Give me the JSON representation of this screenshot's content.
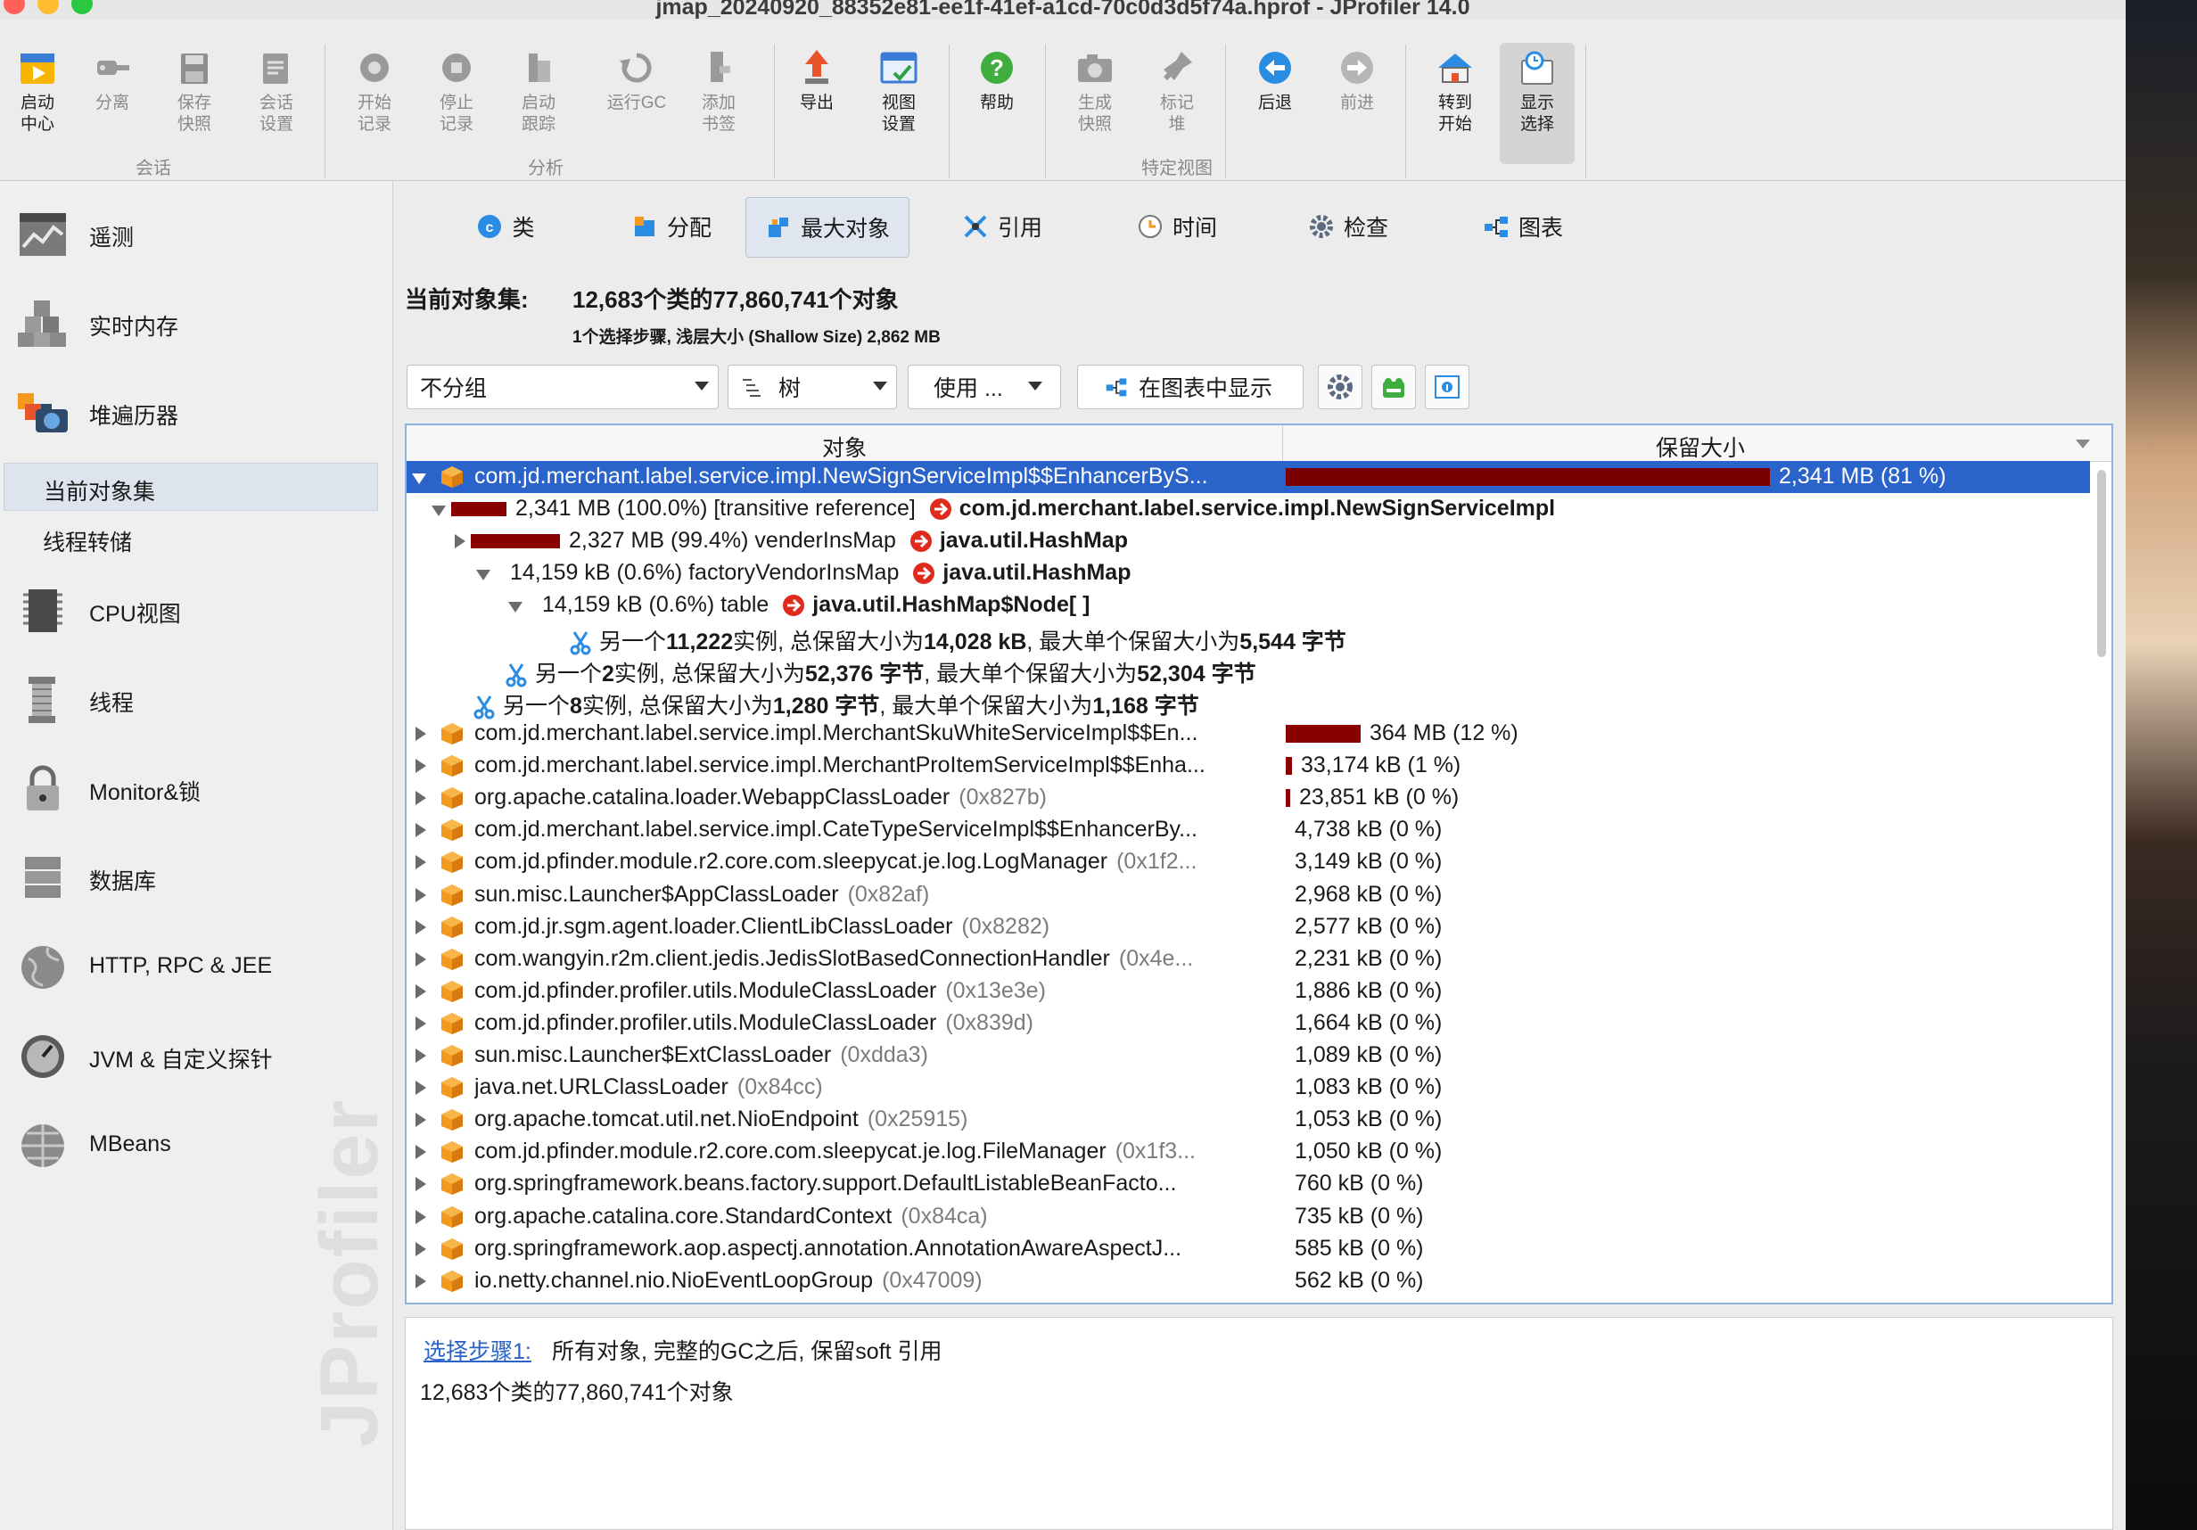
{
  "window": {
    "title": "jmap_20240920_88352e81-ee1f-41ef-a1cd-70c0d3d5f74a.hprof - JProfiler 14.0",
    "watermark": "JProfiler"
  },
  "toolbar": {
    "buttons": [
      {
        "label": "启动\n中心",
        "icon": "launcher-icon"
      },
      {
        "label": "分离",
        "icon": "detach-icon"
      },
      {
        "label": "保存\n快照",
        "icon": "save-icon"
      },
      {
        "label": "会话\n设置",
        "icon": "session-settings-icon"
      },
      {
        "label": "开始\n记录",
        "icon": "start-recording-icon"
      },
      {
        "label": "停止\n记录",
        "icon": "stop-recording-icon"
      },
      {
        "label": "启动\n跟踪",
        "icon": "start-tracking-icon"
      },
      {
        "label": "运行GC",
        "icon": "run-gc-icon"
      },
      {
        "label": "添加\n书签",
        "icon": "bookmark-icon"
      },
      {
        "label": "导出",
        "icon": "export-icon"
      },
      {
        "label": "视图\n设置",
        "icon": "view-settings-icon"
      },
      {
        "label": "帮助",
        "icon": "help-icon"
      },
      {
        "label": "生成\n快照",
        "icon": "snapshot-icon"
      },
      {
        "label": "标记\n堆",
        "icon": "mark-heap-icon"
      },
      {
        "label": "后退",
        "icon": "back-icon"
      },
      {
        "label": "前进",
        "icon": "forward-icon"
      },
      {
        "label": "转到\n开始",
        "icon": "home-icon"
      },
      {
        "label": "显示\n选择",
        "icon": "show-selection-icon"
      }
    ],
    "groups": {
      "session": "会话",
      "profiling": "分析",
      "view": "特定视图"
    }
  },
  "sidebar": {
    "items": [
      {
        "label": "遥测"
      },
      {
        "label": "实时内存"
      },
      {
        "label": "堆遍历器"
      },
      {
        "label": "CPU视图"
      },
      {
        "label": "线程"
      },
      {
        "label": "Monitor&锁"
      },
      {
        "label": "数据库"
      },
      {
        "label": "HTTP, RPC & JEE"
      },
      {
        "label": "JVM & 自定义探针"
      },
      {
        "label": "MBeans"
      }
    ],
    "sub_items": [
      {
        "label": "当前对象集"
      },
      {
        "label": "线程转储"
      }
    ]
  },
  "tabs": [
    {
      "label": "类"
    },
    {
      "label": "分配"
    },
    {
      "label": "最大对象"
    },
    {
      "label": "引用"
    },
    {
      "label": "时间"
    },
    {
      "label": "检查"
    },
    {
      "label": "图表"
    }
  ],
  "object_set": {
    "label": "当前对象集:",
    "value": "12,683个类的77,860,741个对象",
    "sub": "1个选择步骤, 浅层大小 (Shallow Size) 2,862 MB"
  },
  "controls": {
    "grouping": "不分组",
    "view_mode": "树",
    "use": "使用 ...",
    "show_in_graph": "在图表中显示"
  },
  "table": {
    "col_object": "对象",
    "col_retained": "保留大小",
    "rows": [
      {
        "name": "com.jd.merchant.label.service.impl.NewSignServiceImpl$$EnhancerByS...",
        "id": "",
        "retained": "2,341 MB (81 %)",
        "pct": 0.81
      },
      {
        "name": "com.jd.merchant.label.service.impl.MerchantSkuWhiteServiceImpl$$En...",
        "id": "",
        "retained": "364 MB (12 %)",
        "pct": 0.126
      },
      {
        "name": "com.jd.merchant.label.service.impl.MerchantProItemServiceImpl$$Enha...",
        "id": "",
        "retained": "33,174 kB (1 %)",
        "pct": 0.011
      },
      {
        "name": "org.apache.catalina.loader.WebappClassLoader",
        "id": "(0x827b)",
        "retained": "23,851 kB (0 %)",
        "pct": 0.008
      },
      {
        "name": "com.jd.merchant.label.service.impl.CateTypeServiceImpl$$EnhancerBy...",
        "id": "",
        "retained": "4,738 kB (0 %)",
        "pct": 0
      },
      {
        "name": "com.jd.pfinder.module.r2.core.com.sleepycat.je.log.LogManager",
        "id": "(0x1f2...",
        "retained": "3,149 kB (0 %)",
        "pct": 0
      },
      {
        "name": "sun.misc.Launcher$AppClassLoader",
        "id": "(0x82af)",
        "retained": "2,968 kB (0 %)",
        "pct": 0
      },
      {
        "name": "com.jd.jr.sgm.agent.loader.ClientLibClassLoader",
        "id": "(0x8282)",
        "retained": "2,577 kB (0 %)",
        "pct": 0
      },
      {
        "name": "com.wangyin.r2m.client.jedis.JedisSlotBasedConnectionHandler",
        "id": "(0x4e...",
        "retained": "2,231 kB (0 %)",
        "pct": 0
      },
      {
        "name": "com.jd.pfinder.profiler.utils.ModuleClassLoader",
        "id": "(0x13e3e)",
        "retained": "1,886 kB (0 %)",
        "pct": 0
      },
      {
        "name": "com.jd.pfinder.profiler.utils.ModuleClassLoader",
        "id": "(0x839d)",
        "retained": "1,664 kB (0 %)",
        "pct": 0
      },
      {
        "name": "sun.misc.Launcher$ExtClassLoader",
        "id": "(0xdda3)",
        "retained": "1,089 kB (0 %)",
        "pct": 0
      },
      {
        "name": "java.net.URLClassLoader",
        "id": "(0x84cc)",
        "retained": "1,083 kB (0 %)",
        "pct": 0
      },
      {
        "name": "org.apache.tomcat.util.net.NioEndpoint",
        "id": "(0x25915)",
        "retained": "1,053 kB (0 %)",
        "pct": 0
      },
      {
        "name": "com.jd.pfinder.module.r2.core.com.sleepycat.je.log.FileManager",
        "id": "(0x1f3...",
        "retained": "1,050 kB (0 %)",
        "pct": 0
      },
      {
        "name": "org.springframework.beans.factory.support.DefaultListableBeanFacto...",
        "id": "",
        "retained": "760 kB (0 %)",
        "pct": 0
      },
      {
        "name": "org.apache.catalina.core.StandardContext",
        "id": "(0x84ca)",
        "retained": "735 kB (0 %)",
        "pct": 0
      },
      {
        "name": "org.springframework.aop.aspectj.annotation.AnnotationAwareAspectJ...",
        "id": "",
        "retained": "585 kB (0 %)",
        "pct": 0
      },
      {
        "name": "io.netty.channel.nio.NioEventLoopGroup",
        "id": "(0x47009)",
        "retained": "562 kB (0 %)",
        "pct": 0
      }
    ],
    "children": {
      "c1_size": "2,341 MB (100.0%) [transitive reference]",
      "c1_target": "com.jd.merchant.label.service.impl.NewSignServiceImpl",
      "c2_size": "2,327 MB (99.4%) venderInsMap",
      "c2_target": "java.util.HashMap",
      "c3_size": "14,159 kB (0.6%) factoryVendorInsMap",
      "c3_target": "java.util.HashMap",
      "c4_size": "14,159 kB (0.6%) table",
      "c4_target": "java.util.HashMap$Node[ ]",
      "more1": {
        "a": "另一个",
        "n": "11,222",
        "b": "实例, 总保留大小为",
        "total": "14,028 kB",
        "c": ", 最大单个保留大小为",
        "max": "5,544 字节"
      },
      "more2": {
        "a": "另一个",
        "n": "2",
        "b": "实例, 总保留大小为",
        "total": "52,376 字节",
        "c": ", 最大单个保留大小为",
        "max": "52,304 字节"
      },
      "more3": {
        "a": "另一个",
        "n": "8",
        "b": "实例, 总保留大小为",
        "total": "1,280 字节",
        "c": ", 最大单个保留大小为",
        "max": "1,168 字节"
      }
    }
  },
  "info": {
    "step_link": "选择步骤1:",
    "step_desc": "所有对象, 完整的GC之后, 保留soft 引用",
    "count": "12,683个类的77,860,741个对象"
  },
  "colors": {
    "accent": "#2a63c9",
    "bar": "#8a0000",
    "cube": "#f39a1e"
  }
}
